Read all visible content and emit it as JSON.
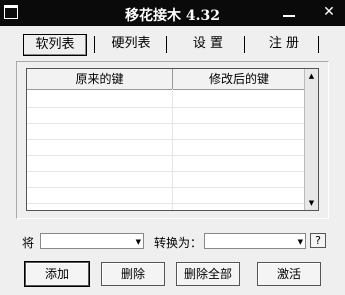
{
  "window": {
    "title": "移花接木 4.32"
  },
  "tabs": [
    {
      "label": "软列表",
      "active": true
    },
    {
      "label": "硬列表",
      "active": false
    },
    {
      "label": "设 置",
      "active": false
    },
    {
      "label": "注 册",
      "active": false
    }
  ],
  "list": {
    "columns": [
      "原来的键",
      "修改后的键"
    ],
    "rows": []
  },
  "form": {
    "from_label": "将",
    "from_value": "",
    "to_label": "转换为：",
    "to_value": "",
    "help_label": "?"
  },
  "buttons": {
    "add": "添加",
    "delete": "删除",
    "delete_all": "删除全部",
    "activate": "激活"
  }
}
